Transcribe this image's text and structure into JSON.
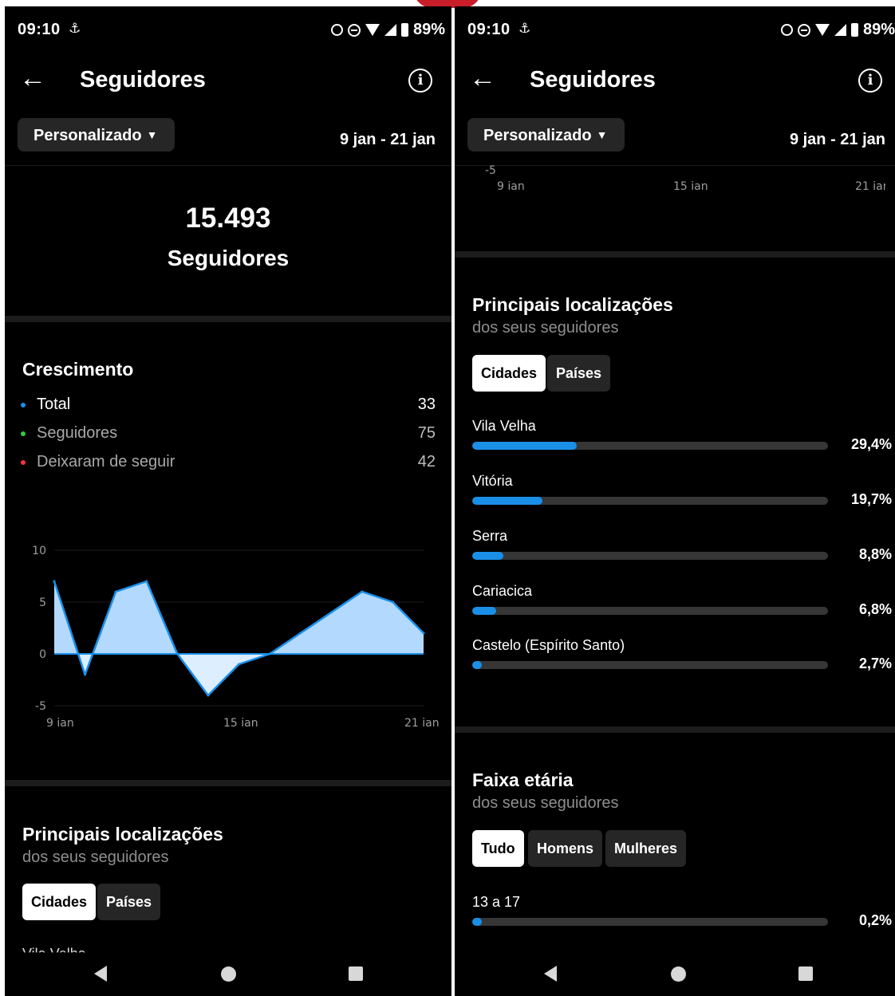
{
  "status_bar": {
    "time": "09:10",
    "battery": "89%"
  },
  "header": {
    "title": "Seguidores"
  },
  "filter": {
    "label": "Personalizado",
    "range": "9 jan - 21 jan"
  },
  "followers": {
    "count": "15.493",
    "label": "Seguidores"
  },
  "growth": {
    "title": "Crescimento",
    "legend": [
      {
        "label": "Total",
        "value": "33",
        "color": "#1a8fe8"
      },
      {
        "label": "Seguidores",
        "value": "75",
        "color": "#2ecc40"
      },
      {
        "label": "Deixaram de seguir",
        "value": "42",
        "color": "#ff3040"
      }
    ]
  },
  "chart_data": {
    "type": "area",
    "y_ticks": [
      "10",
      "5",
      "0",
      "-5"
    ],
    "ylim": [
      -5,
      10
    ],
    "x_tick_labels": [
      "9 ian",
      "15 ian",
      "21 ian"
    ],
    "x": [
      "9 ian",
      "10 ian",
      "11 ian",
      "12 ian",
      "13 ian",
      "14 ian",
      "15 ian",
      "16 ian",
      "17 ian",
      "18 ian",
      "19 ian",
      "20 ian",
      "21 ian"
    ],
    "values": [
      7,
      -2,
      6,
      7,
      0,
      -4,
      -1,
      0,
      2,
      4,
      6,
      5,
      2
    ],
    "grid": true,
    "colors": {
      "fill": "#b3d9ff",
      "line": "#1a8fe8",
      "negative_fill": "#dceeff"
    }
  },
  "locations": {
    "title": "Principais localizações",
    "subtitle": "dos seus seguidores",
    "tabs": [
      {
        "label": "Cidades",
        "active": true
      },
      {
        "label": "Países",
        "active": false
      }
    ],
    "items": [
      {
        "name": "Vila Velha",
        "percent": "29,4%",
        "value": 29.4
      },
      {
        "name": "Vitória",
        "percent": "19,7%",
        "value": 19.7
      },
      {
        "name": "Serra",
        "percent": "8,8%",
        "value": 8.8
      },
      {
        "name": "Cariacica",
        "percent": "6,8%",
        "value": 6.8
      },
      {
        "name": "Castelo (Espírito Santo)",
        "percent": "2,7%",
        "value": 2.7
      }
    ]
  },
  "age": {
    "title": "Faixa etária",
    "subtitle": "dos seus seguidores",
    "tabs": [
      {
        "label": "Tudo",
        "active": true
      },
      {
        "label": "Homens",
        "active": false
      },
      {
        "label": "Mulheres",
        "active": false
      }
    ],
    "items": [
      {
        "name": "13 a 17",
        "percent": "0,2%",
        "value": 0.2
      }
    ]
  },
  "colors": {
    "accent": "#1a8fe8",
    "background": "#000000"
  }
}
